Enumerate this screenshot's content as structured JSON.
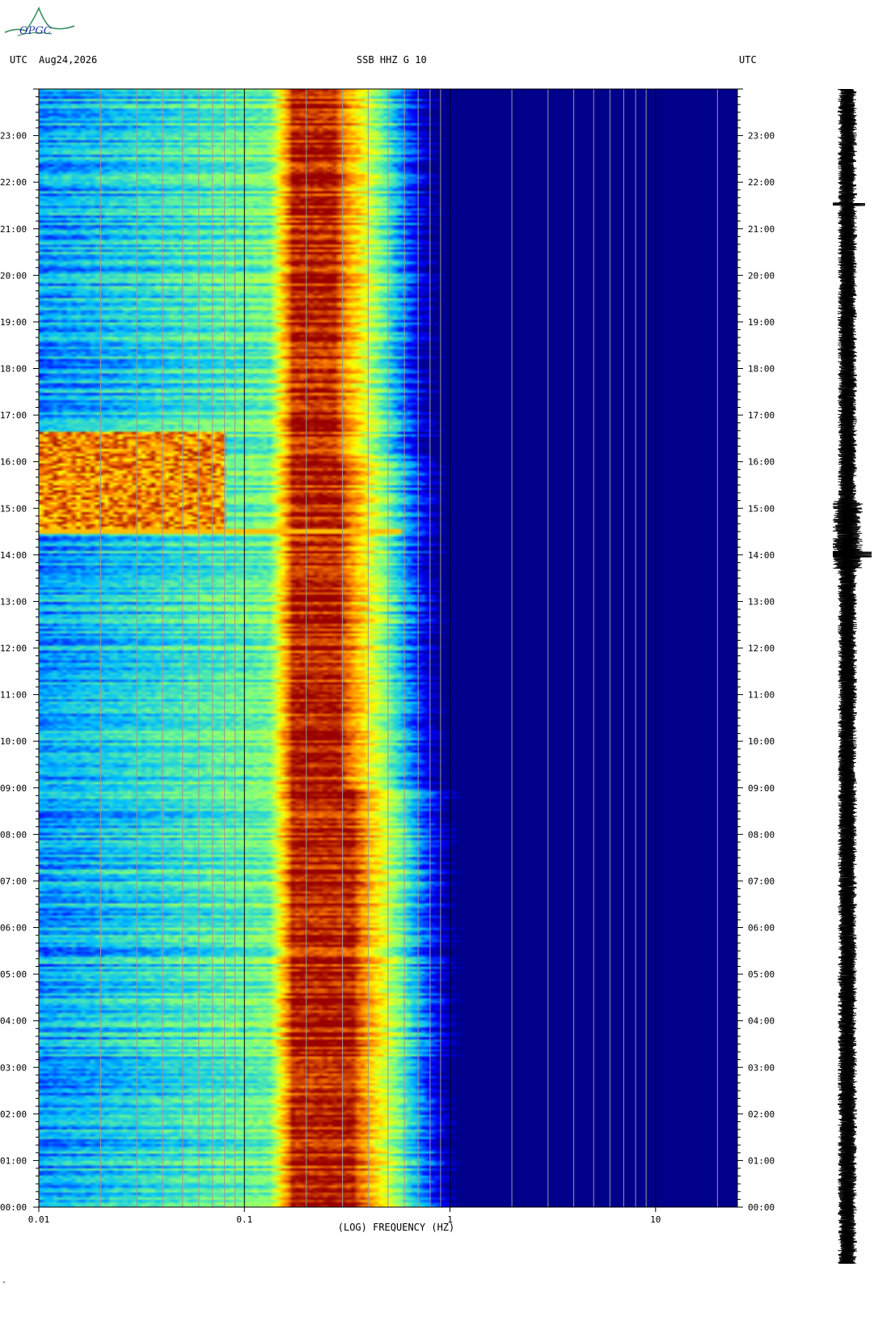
{
  "header": {
    "timezone_left": "UTC",
    "date": "Aug24,2026",
    "station": "SSB HHZ G 10",
    "timezone_right": "UTC"
  },
  "logo": {
    "text": "OPGC"
  },
  "footer": {
    "mark": "·"
  },
  "chart_data": {
    "type": "heatmap",
    "title": "SSB HHZ G 10",
    "xlabel": "(LOG) FREQUENCY (HZ)",
    "ylabel": "",
    "x_scale": "log",
    "xlim": [
      0.01,
      25
    ],
    "ylim": [
      "00:00",
      "24:00"
    ],
    "x_ticks": [
      "0.01",
      "0.1",
      "1",
      "10"
    ],
    "y_ticks": [
      "00:00",
      "01:00",
      "02:00",
      "03:00",
      "04:00",
      "05:00",
      "06:00",
      "07:00",
      "08:00",
      "09:00",
      "10:00",
      "11:00",
      "12:00",
      "13:00",
      "14:00",
      "15:00",
      "16:00",
      "17:00",
      "18:00",
      "19:00",
      "20:00",
      "21:00",
      "22:00",
      "23:00"
    ],
    "microseism_peak_hz": [
      0.17,
      0.3
    ],
    "event": {
      "time": "14:30",
      "extent_hz": 0.6
    },
    "long_period_burst": {
      "start": "14:30",
      "end": "16:40",
      "max_hz": 0.08
    },
    "colormap": [
      "#00008b",
      "#0000ff",
      "#00bfff",
      "#7fff7f",
      "#ffff00",
      "#ff7f00",
      "#990000"
    ]
  }
}
